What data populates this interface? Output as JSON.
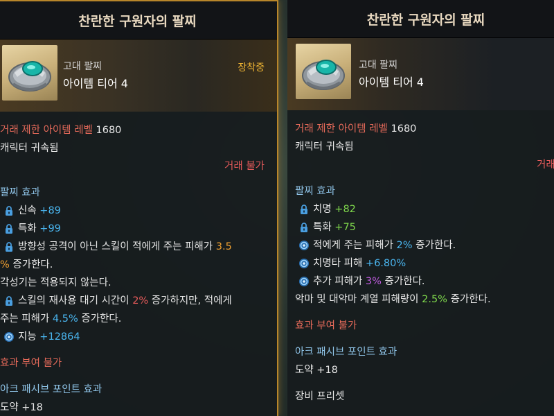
{
  "left": {
    "title": "찬란한 구원자의 팔찌",
    "item_type": "고대 팔찌",
    "tier": "아이템 티어 4",
    "equipped": "장착중",
    "trade_label": "거래 제한 아이템 레벨",
    "trade_level": "1680",
    "bound": "캐릭터 귀속됨",
    "trade_no": "거래 불가",
    "effects_title": "팔찌 효과",
    "stat1_name": "신속",
    "stat1_val": "+89",
    "stat2_name": "특화",
    "stat2_val": "+99",
    "eff3_a": "방향성 공격이 아닌 스킬이 적에게 주는 피해가 ",
    "eff3_val": "3.5",
    "eff3_pct": "%",
    "eff3_b": " 증가한다.",
    "eff3_note": "각성기는 적용되지 않는다.",
    "eff4_a": "스킬의 재사용 대기 시간이 ",
    "eff4_val1": "2%",
    "eff4_b": " 증가하지만, 적에게",
    "eff4_c": "주는 피해가 ",
    "eff4_val2": "4.5%",
    "eff4_d": " 증가한다.",
    "stat5_name": "지능",
    "stat5_val": "+12864",
    "no_enchant": "효과 부여 불가",
    "ark_title": "아크 패시브 포인트 효과",
    "ark_name": "도약",
    "ark_val": "+18"
  },
  "right": {
    "title": "찬란한 구원자의 팔찌",
    "item_type": "고대 팔찌",
    "tier": "아이템 티어 4",
    "trade_label": "거래 제한 아이템 레벨",
    "trade_level": "1680",
    "bound": "캐릭터 귀속됨",
    "trade_no": "거래 불가",
    "effects_title": "팔찌 효과",
    "stat1_name": "치명",
    "stat1_val": "+82",
    "stat2_name": "특화",
    "stat2_val": "+75",
    "eff3_a": "적에게 주는 피해가 ",
    "eff3_val": "2%",
    "eff3_b": " 증가한다.",
    "eff4_a": "치명타 피해 ",
    "eff4_val": "+6.80%",
    "eff5_a": "추가 피해가 ",
    "eff5_val": "3%",
    "eff5_b": " 증가한다.",
    "eff6_a": "악마 및 대악마 계열 피해량이 ",
    "eff6_val": "2.5%",
    "eff6_b": " 증가한다.",
    "no_enchant": "효과 부여 불가",
    "ark_title": "아크 패시브 포인트 효과",
    "ark_name": "도약",
    "ark_val": "+18",
    "preset": "장비 프리셋"
  },
  "colors": {
    "red": "#e85b5b",
    "blue": "#4ab6f0",
    "green": "#7fd84c",
    "orange": "#f0a030",
    "purple": "#c05ce0",
    "gold_border": "#b8862a"
  }
}
